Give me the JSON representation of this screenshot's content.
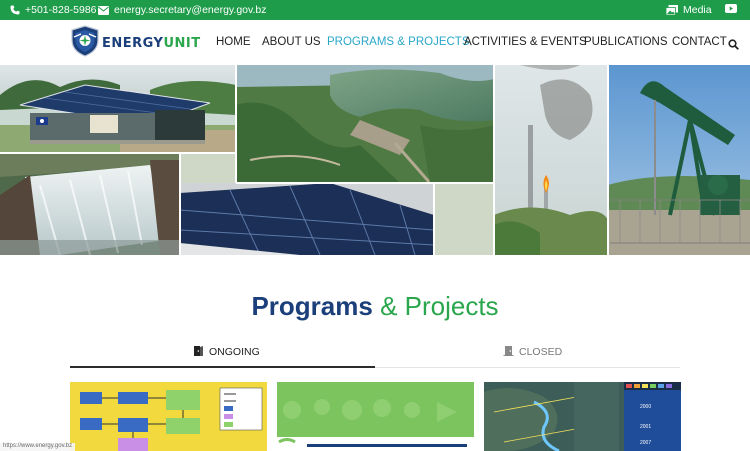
{
  "topbar": {
    "phone": "+501-828-5986",
    "email": "energy.secretary@energy.gov.bz",
    "media_label": "Media",
    "phone_icon": "phone-icon",
    "email_icon": "envelope-icon",
    "media_icon": "images-icon",
    "youtube_icon": "youtube-icon"
  },
  "logo": {
    "part1": "ENERGY",
    "part2": "UNIT"
  },
  "nav": {
    "items": [
      {
        "label": "HOME"
      },
      {
        "label": "ABOUT US"
      },
      {
        "label": "PROGRAMS & PROJECTS",
        "active": true
      },
      {
        "label": "ACTIVITIES & EVENTS"
      },
      {
        "label": "PUBLICATIONS"
      },
      {
        "label": "CONTACT"
      }
    ],
    "search_icon": "search-icon"
  },
  "section": {
    "title_strong": "Programs",
    "title_rest": "& Projects"
  },
  "tabs": {
    "ongoing": {
      "label": "ONGOING",
      "icon": "door-open-icon"
    },
    "closed": {
      "label": "CLOSED",
      "icon": "door-closed-icon"
    }
  },
  "cards": {
    "map_years": [
      "2000",
      "2001",
      "2007"
    ]
  },
  "status_url": "https://www.energy.gov.bz",
  "colors": {
    "topbar": "#1e9c4a",
    "brand_blue": "#1b3f7a",
    "brand_green": "#2aa64d",
    "nav_active": "#28a7c9"
  }
}
